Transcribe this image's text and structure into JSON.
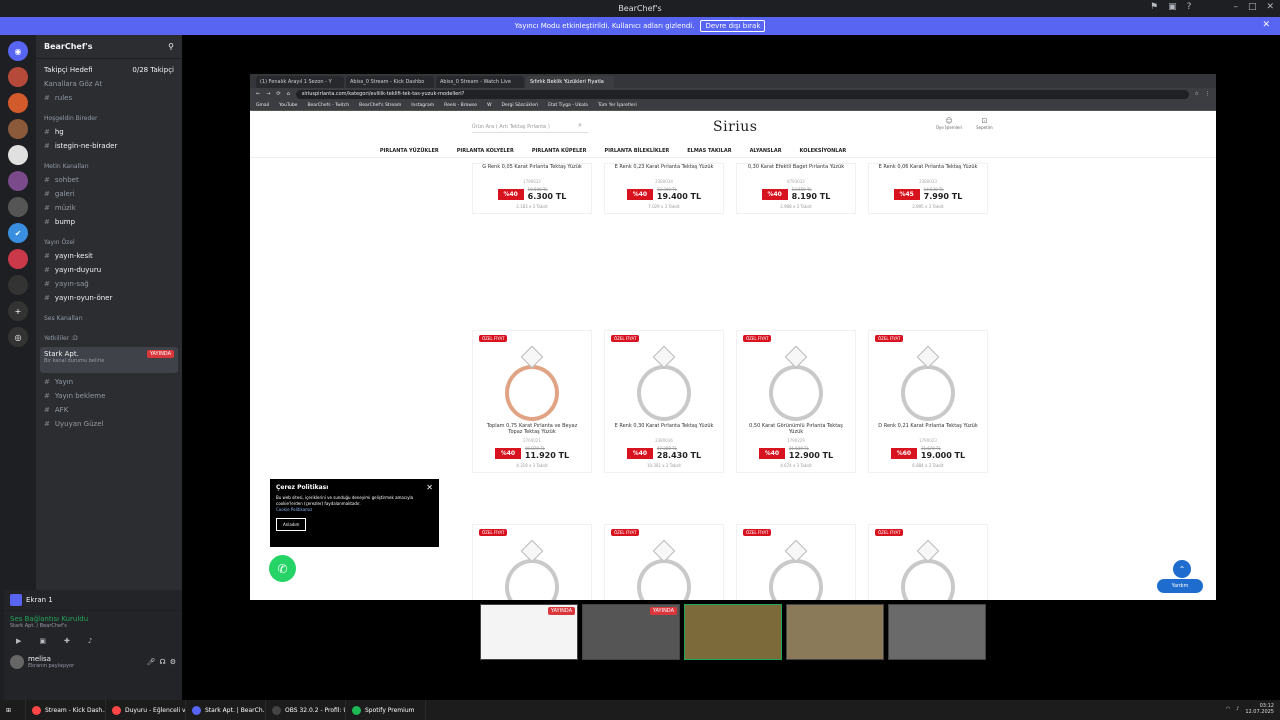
{
  "window": {
    "title": "BearChef's"
  },
  "notice": {
    "text": "Yayıncı Modu etkinleştirildi. Kullanıcı adları gizlendi.",
    "button": "Devre dışı bırak"
  },
  "sidebar": {
    "server_name": "BearChef's",
    "follow": {
      "label": "Takipçi Hedefi",
      "value": "0/28 Takipçi"
    },
    "rows": [
      {
        "type": "text",
        "label": "Kanallara Göz At"
      },
      {
        "type": "channel",
        "label": "rules"
      },
      {
        "type": "cat",
        "label": "Hoşgeldin Bireder"
      },
      {
        "type": "channel",
        "label": "hg",
        "hl": true
      },
      {
        "type": "channel",
        "label": "istegin-ne-birader",
        "hl": true
      },
      {
        "type": "cat",
        "label": "Metin Kanalları"
      },
      {
        "type": "channel",
        "label": "sohbet"
      },
      {
        "type": "channel",
        "label": "galeri"
      },
      {
        "type": "channel",
        "label": "müzik"
      },
      {
        "type": "channel",
        "label": "bump",
        "hl": true
      },
      {
        "type": "cat",
        "label": "Yayın Özel"
      },
      {
        "type": "channel",
        "label": "yayın-kesit",
        "hl": true
      },
      {
        "type": "channel",
        "label": "yayın-duyuru",
        "hl": true
      },
      {
        "type": "channel",
        "label": "yayın-sağ"
      },
      {
        "type": "channel",
        "label": "yayın-oyun-öner",
        "hl": true
      },
      {
        "type": "cat",
        "label": "Ses Kanalları"
      },
      {
        "type": "cat",
        "label": "Yetkililer :D"
      }
    ],
    "live": {
      "name": "Stark Apt.",
      "tag": "YAYINDA",
      "sub": "Bir kanal durumu belirle"
    },
    "rows2": [
      {
        "type": "channel",
        "label": "Yayın"
      },
      {
        "type": "channel",
        "label": "Yayın bekleme"
      },
      {
        "type": "channel",
        "label": "AFK"
      },
      {
        "type": "channel",
        "label": "Uyuyan Güzel"
      }
    ],
    "screen": "Ekran 1",
    "voice": {
      "status": "Ses Bağlantısı Kuruldu",
      "channel": "Stark Apt. / BearChef's"
    },
    "user": {
      "name": "melisa",
      "status": "Ekranın paylaşıyor"
    }
  },
  "browser": {
    "tabs": [
      "(1) Fenalık Arayıl 1 Sezon - Y",
      "Abiss_0 Stream - Kick Dashbo",
      "Abiss_0 Stream - Watch Live",
      "Sıfırlık Beklik Yüzükleri Fiyatla"
    ],
    "active_tab": 3,
    "url": "siriuspirlanta.com/kategori/evlilik-teklifi-tek-tas-yuzuk-modelleri?",
    "bookmarks": [
      "Gmail",
      "YouTube",
      "BearChefs - Twitch",
      "BearChef's Stream",
      "Instagram",
      "Reels - Browse",
      "W",
      "Dergi Sözcükleri",
      "Etat Tiyga - Ukala",
      "Tüm Yer İşaretleri"
    ]
  },
  "site": {
    "search_placeholder": "Ürün Ara ( Artı Tektaş Pırlanta )",
    "logo": "Sirius",
    "header_icons": [
      "Üye İşlemleri",
      "Sepetim"
    ],
    "nav": [
      "PIRLANTA YÜZÜKLER",
      "PIRLANTA KOLYELER",
      "PIRLANTA KÜPELER",
      "PIRLANTA BİLEKLİKLER",
      "ELMAS TAKILAR",
      "ALYANSLAR",
      "KOLEKSİYONLAR"
    ],
    "products_row1": [
      {
        "name": "G Renk 0,05 Karat Pırlanta Tektaş Yüzük",
        "code": "1796632",
        "disc": "%40",
        "old": "10.500 TL",
        "price": "6.300 TL",
        "inst": "2.183 x 3 Taksit"
      },
      {
        "name": "E Renk 0,23 Karat Pırlanta Tektaş Yüzük",
        "code": "2380034",
        "disc": "%40",
        "old": "32.340 TL",
        "price": "19.400 TL",
        "inst": "7.029 x 3 Taksit"
      },
      {
        "name": "0,30 Karat Efektli Baget Pırlanta Yüzük",
        "code": "8793032",
        "disc": "%40",
        "old": "13.650 TL",
        "price": "8.190 TL",
        "inst": "2.968 x 3 Taksit"
      },
      {
        "name": "E Renk 0,06 Karat Pırlanta Tektaş Yüzük",
        "code": "2380033",
        "disc": "%45",
        "old": "14.530 TL",
        "price": "7.990 TL",
        "inst": "2.895 x 3 Taksit"
      }
    ],
    "products_row2": [
      {
        "badge": "ÖZEL FİYAT",
        "name": "Toplam 0,75 Karat Pırlanta ve Beyaz Topaz Tektaş Yüzük",
        "code": "2760021",
        "disc": "%40",
        "old": "19.870 TL",
        "price": "11.920 TL",
        "inst": "4.319 x 3 Taksit",
        "rose": true
      },
      {
        "badge": "ÖZEL FİYAT",
        "name": "E Renk 0,30 Karat Pırlanta Tektaş Yüzük",
        "code": "2380036",
        "disc": "%40",
        "old": "47.380 TL",
        "price": "28.430 TL",
        "inst": "10.301 x 3 Taksit"
      },
      {
        "badge": "ÖZEL FİYAT",
        "name": "0,50 Karat Görünümlü Pırlanta Tektaş Yüzük",
        "code": "1790229",
        "disc": "%40",
        "old": "21.500 TL",
        "price": "12.900 TL",
        "inst": "4.674 x 3 Taksit"
      },
      {
        "badge": "ÖZEL FİYAT",
        "name": "D Renk 0,21 Karat Pırlanta Tektaş Yüzük",
        "code": "1790023",
        "disc": "%60",
        "old": "31.670 TL",
        "price": "19.000 TL",
        "inst": "6.884 x 3 Taksit"
      }
    ],
    "products_row3_badges": [
      "ÖZEL FİYAT",
      "ÖZEL FİYAT",
      "ÖZEL FİYAT",
      "ÖZEL FİYAT"
    ],
    "cookie": {
      "title": "Çerez Politikası",
      "text": "Bu web sitesi, içeriklerini ve sunduğu deneyimi geliştirmek amacıyla cookie'lerden (çerezler) faydalanmaktadır.",
      "link": "Cookie Politikamız",
      "ok": "Anladım"
    },
    "help": "Yardım"
  },
  "stream_thumbs": [
    {
      "tag": "YAYINDA"
    },
    {
      "tag": "YAYINDA"
    },
    {
      "tag": ""
    },
    {
      "tag": ""
    },
    {
      "tag": ""
    }
  ],
  "taskbar": {
    "items": [
      "Stream - Kick Dash...",
      "Duyuru - Eğlenceli v...",
      "Stark Apt. | BearCh...",
      "OBS 32.0.2 - Profil: U...",
      "Spotify Premium"
    ],
    "colors": [
      "#ff4545",
      "#ff4545",
      "#5865f2",
      "#444444",
      "#1db954"
    ],
    "time": "03:12",
    "date": "12.07.2025"
  }
}
